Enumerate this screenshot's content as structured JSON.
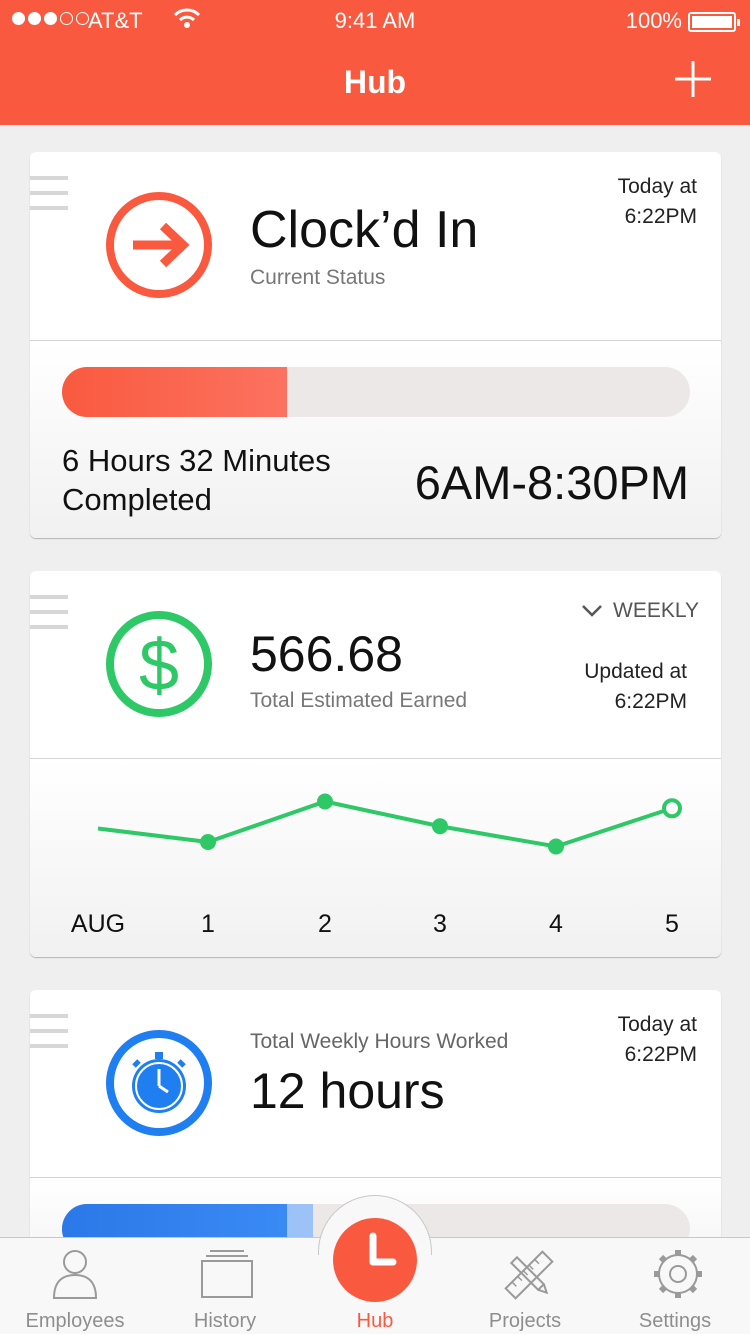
{
  "status_bar": {
    "carrier": "AT&T",
    "time": "9:41 AM",
    "battery": "100%"
  },
  "nav": {
    "title": "Hub",
    "add_icon": "plus-icon"
  },
  "colors": {
    "accent": "#f95a3f",
    "green": "#2ec866",
    "blue": "#1f7ef0"
  },
  "clock_card": {
    "status": "Clock’d In",
    "status_label": "Current Status",
    "timestamp_line1": "Today at",
    "timestamp_line2": "6:22PM",
    "progress_fraction": 0.358,
    "completed_line1": "6 Hours 32 Minutes",
    "completed_line2": "Completed",
    "shift": "6AM-8:30PM"
  },
  "earnings_card": {
    "amount": "566.68",
    "amount_label": "Total Estimated Earned",
    "period": "WEEKLY",
    "updated_line1": "Updated at",
    "updated_line2": "6:22PM"
  },
  "chart_data": {
    "type": "line",
    "categories": [
      "AUG",
      "1",
      "2",
      "3",
      "4",
      "5"
    ],
    "values": [
      569,
      566,
      575,
      569.5,
      565,
      573.5
    ],
    "ylim": [
      560,
      580
    ],
    "color": "#2ec866",
    "last_point_open": true,
    "grid": false
  },
  "hours_card": {
    "label": "Total Weekly Hours Worked",
    "value": "12 hours",
    "timestamp_line1": "Today at",
    "timestamp_line2": "6:22PM",
    "progress_fraction": 0.358,
    "progress_extra_fraction": 0.042
  },
  "tabbar": {
    "items": [
      {
        "label": "Employees",
        "icon": "person-icon"
      },
      {
        "label": "History",
        "icon": "stack-icon"
      },
      {
        "label": "Hub",
        "icon": "clock-icon"
      },
      {
        "label": "Projects",
        "icon": "ruler-pencil-icon"
      },
      {
        "label": "Settings",
        "icon": "gear-icon"
      }
    ],
    "active_index": 2
  }
}
